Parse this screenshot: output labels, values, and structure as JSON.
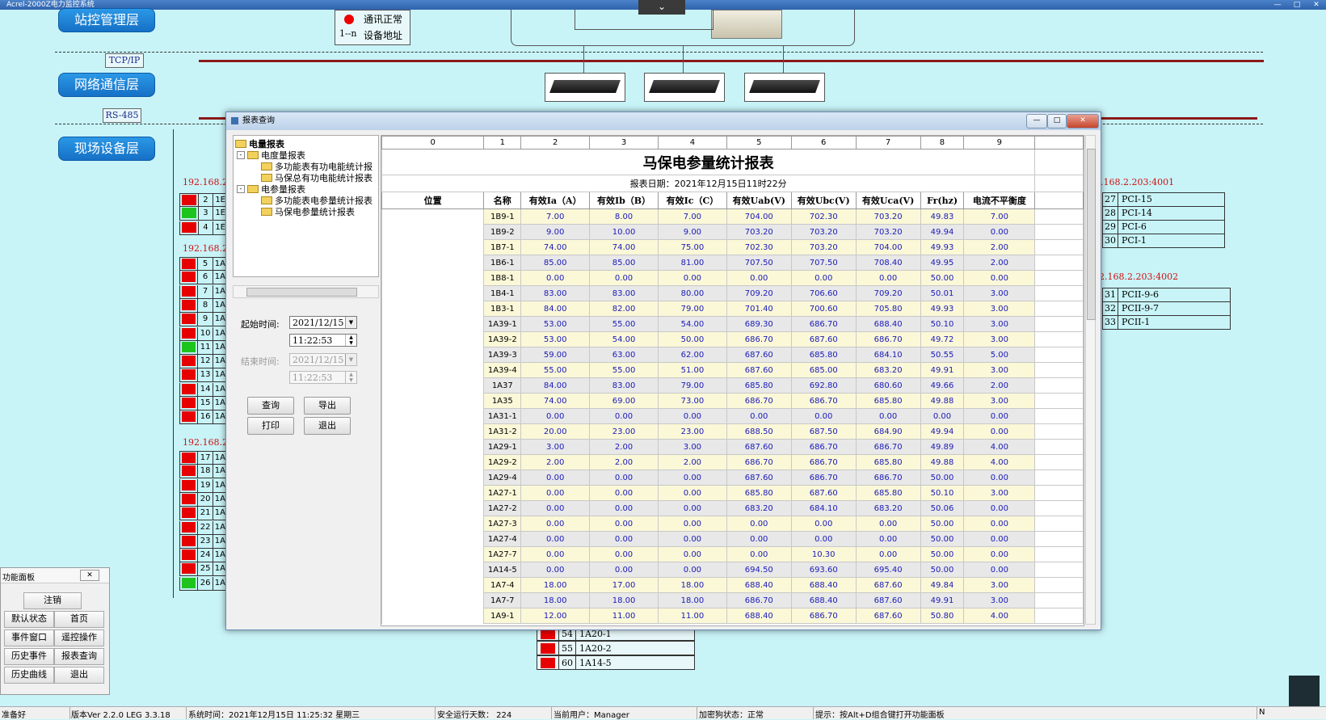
{
  "window": {
    "title": "Acrel-2000Z电力监控系统"
  },
  "layers": {
    "station": "站控管理层",
    "network": "网络通信层",
    "field": "现场设备层",
    "tcp": "TCP/IP",
    "rs485": "RS-485"
  },
  "legend": {
    "ok": "通讯正常",
    "addr_prefix": "1--n",
    "addr": "设备地址"
  },
  "left_devices": {
    "ip1": "192.168.2.",
    "ip2": "192.168.2.",
    "ip3": "192.168.2.",
    "group1": [
      {
        "n": "2",
        "k": "1E",
        "status": "red"
      },
      {
        "n": "3",
        "k": "1E",
        "status": "green"
      },
      {
        "n": "4",
        "k": "1E",
        "status": "red"
      }
    ],
    "group2": [
      {
        "n": "5",
        "k": "1A",
        "status": "red"
      },
      {
        "n": "6",
        "k": "1A",
        "status": "red"
      },
      {
        "n": "7",
        "k": "1A",
        "status": "red"
      },
      {
        "n": "8",
        "k": "1A",
        "status": "red"
      },
      {
        "n": "9",
        "k": "1A",
        "status": "red"
      },
      {
        "n": "10",
        "k": "1A",
        "status": "red"
      },
      {
        "n": "11",
        "k": "1A",
        "status": "green"
      },
      {
        "n": "12",
        "k": "1A",
        "status": "red"
      },
      {
        "n": "13",
        "k": "1A",
        "status": "red"
      },
      {
        "n": "14",
        "k": "1A",
        "status": "red"
      },
      {
        "n": "15",
        "k": "1A",
        "status": "red"
      },
      {
        "n": "16",
        "k": "1A",
        "status": "red"
      }
    ],
    "group3": [
      {
        "n": "17",
        "k": "1A",
        "status": "red"
      },
      {
        "n": "18",
        "k": "1A",
        "status": "red"
      },
      {
        "n": "19",
        "k": "1A",
        "status": "red"
      },
      {
        "n": "20",
        "k": "1A",
        "status": "red"
      },
      {
        "n": "21",
        "k": "1A",
        "status": "red"
      },
      {
        "n": "22",
        "k": "1A",
        "status": "red"
      },
      {
        "n": "23",
        "k": "1A",
        "status": "red"
      },
      {
        "n": "24",
        "k": "1A",
        "status": "red"
      },
      {
        "n": "25",
        "k": "1A",
        "status": "red"
      },
      {
        "n": "26",
        "k": "1A",
        "status": "green"
      }
    ]
  },
  "right_devices": {
    "ip1": ".168.2.203:4001",
    "ip2": "2.168.2.203:4002",
    "group1": [
      {
        "n": "27",
        "k": "PCI-15"
      },
      {
        "n": "28",
        "k": "PCI-14"
      },
      {
        "n": "29",
        "k": "PCI-6"
      },
      {
        "n": "30",
        "k": "PCI-1"
      }
    ],
    "group2": [
      {
        "n": "31",
        "k": "PCII-9-6"
      },
      {
        "n": "32",
        "k": "PCII-9-7"
      },
      {
        "n": "33",
        "k": "PCII-1"
      }
    ]
  },
  "bottom_devices": [
    {
      "n": "54",
      "k": "1A20-1"
    },
    {
      "n": "55",
      "k": "1A20-2"
    },
    {
      "n": "60",
      "k": "1A14-5"
    }
  ],
  "dialog": {
    "title": "报表查询",
    "tree": {
      "root": "电量报表",
      "energy": "电度量报表",
      "energy_items": [
        "多功能表有功电能统计报",
        "马保总有功电能统计报表"
      ],
      "param": "电参量报表",
      "param_items": [
        "多功能表电参量统计报表",
        "马保电参量统计报表"
      ]
    },
    "start_label": "起始时间:",
    "start_date": "2021/12/15",
    "start_time": "11:22:53",
    "end_label": "结束时间:",
    "end_date": "2021/12/15",
    "end_time": "11:22:53",
    "buttons": {
      "query": "查询",
      "export": "导出",
      "print": "打印",
      "exit": "退出"
    }
  },
  "report": {
    "col_index": [
      "0",
      "1",
      "2",
      "3",
      "4",
      "5",
      "6",
      "7",
      "8",
      "9"
    ],
    "title": "马保电参量统计报表",
    "date": "报表日期：2021年12月15日11时22分",
    "headers": [
      "位置",
      "名称",
      "有效Ia（A）",
      "有效Ib（B）",
      "有效Ic（C）",
      "有效Uab(V)",
      "有效Ubc(V)",
      "有效Uca(V)",
      "Fr(hz)",
      "电流不平衡度"
    ],
    "rows": [
      [
        "1B9-1",
        "7.00",
        "8.00",
        "7.00",
        "704.00",
        "702.30",
        "703.20",
        "49.83",
        "7.00"
      ],
      [
        "1B9-2",
        "9.00",
        "10.00",
        "9.00",
        "703.20",
        "703.20",
        "703.20",
        "49.94",
        "0.00"
      ],
      [
        "1B7-1",
        "74.00",
        "74.00",
        "75.00",
        "702.30",
        "703.20",
        "704.00",
        "49.93",
        "2.00"
      ],
      [
        "1B6-1",
        "85.00",
        "85.00",
        "81.00",
        "707.50",
        "707.50",
        "708.40",
        "49.95",
        "2.00"
      ],
      [
        "1B8-1",
        "0.00",
        "0.00",
        "0.00",
        "0.00",
        "0.00",
        "0.00",
        "50.00",
        "0.00"
      ],
      [
        "1B4-1",
        "83.00",
        "83.00",
        "80.00",
        "709.20",
        "706.60",
        "709.20",
        "50.01",
        "3.00"
      ],
      [
        "1B3-1",
        "84.00",
        "82.00",
        "79.00",
        "701.40",
        "700.60",
        "705.80",
        "49.93",
        "3.00"
      ],
      [
        "1A39-1",
        "53.00",
        "55.00",
        "54.00",
        "689.30",
        "686.70",
        "688.40",
        "50.10",
        "3.00"
      ],
      [
        "1A39-2",
        "53.00",
        "54.00",
        "50.00",
        "686.70",
        "687.60",
        "686.70",
        "49.72",
        "3.00"
      ],
      [
        "1A39-3",
        "59.00",
        "63.00",
        "62.00",
        "687.60",
        "685.80",
        "684.10",
        "50.55",
        "5.00"
      ],
      [
        "1A39-4",
        "55.00",
        "55.00",
        "51.00",
        "687.60",
        "685.00",
        "683.20",
        "49.91",
        "3.00"
      ],
      [
        "1A37",
        "84.00",
        "83.00",
        "79.00",
        "685.80",
        "692.80",
        "680.60",
        "49.66",
        "2.00"
      ],
      [
        "1A35",
        "74.00",
        "69.00",
        "73.00",
        "686.70",
        "686.70",
        "685.80",
        "49.88",
        "3.00"
      ],
      [
        "1A31-1",
        "0.00",
        "0.00",
        "0.00",
        "0.00",
        "0.00",
        "0.00",
        "0.00",
        "0.00"
      ],
      [
        "1A31-2",
        "20.00",
        "23.00",
        "23.00",
        "688.50",
        "687.50",
        "684.90",
        "49.94",
        "0.00"
      ],
      [
        "1A29-1",
        "3.00",
        "2.00",
        "3.00",
        "687.60",
        "686.70",
        "686.70",
        "49.89",
        "4.00"
      ],
      [
        "1A29-2",
        "2.00",
        "2.00",
        "2.00",
        "686.70",
        "686.70",
        "685.80",
        "49.88",
        "4.00"
      ],
      [
        "1A29-4",
        "0.00",
        "0.00",
        "0.00",
        "687.60",
        "686.70",
        "686.70",
        "50.00",
        "0.00"
      ],
      [
        "1A27-1",
        "0.00",
        "0.00",
        "0.00",
        "685.80",
        "687.60",
        "685.80",
        "50.10",
        "3.00"
      ],
      [
        "1A27-2",
        "0.00",
        "0.00",
        "0.00",
        "683.20",
        "684.10",
        "683.20",
        "50.06",
        "0.00"
      ],
      [
        "1A27-3",
        "0.00",
        "0.00",
        "0.00",
        "0.00",
        "0.00",
        "0.00",
        "50.00",
        "0.00"
      ],
      [
        "1A27-4",
        "0.00",
        "0.00",
        "0.00",
        "0.00",
        "0.00",
        "0.00",
        "50.00",
        "0.00"
      ],
      [
        "1A27-7",
        "0.00",
        "0.00",
        "0.00",
        "0.00",
        "10.30",
        "0.00",
        "50.00",
        "0.00"
      ],
      [
        "1A14-5",
        "0.00",
        "0.00",
        "0.00",
        "694.50",
        "693.60",
        "695.40",
        "50.00",
        "0.00"
      ],
      [
        "1A7-4",
        "18.00",
        "17.00",
        "18.00",
        "688.40",
        "688.40",
        "687.60",
        "49.84",
        "3.00"
      ],
      [
        "1A7-7",
        "18.00",
        "18.00",
        "18.00",
        "686.70",
        "688.40",
        "687.60",
        "49.91",
        "3.00"
      ],
      [
        "1A9-1",
        "12.00",
        "11.00",
        "11.00",
        "688.40",
        "686.70",
        "687.60",
        "50.80",
        "4.00"
      ]
    ]
  },
  "func_panel": {
    "title": "功能面板",
    "logout": "注销",
    "default_state": "默认状态",
    "home": "首页",
    "event_window": "事件窗口",
    "remote_op": "遥控操作",
    "history_event": "历史事件",
    "report_query": "报表查询",
    "history_curve": "历史曲线",
    "exit": "退出"
  },
  "status_bar": {
    "ready": "准备好",
    "version": "版本Ver 2.2.0 LEG 3.3.18",
    "time": "系统时间：2021年12月15日 11:25:32   星期三",
    "days": "安全运行天数： 224",
    "user": "当前用户：Manager",
    "dog": "加密狗状态：正常",
    "hint": "提示：按Alt+D组合键打开功能面板",
    "n": "N"
  }
}
